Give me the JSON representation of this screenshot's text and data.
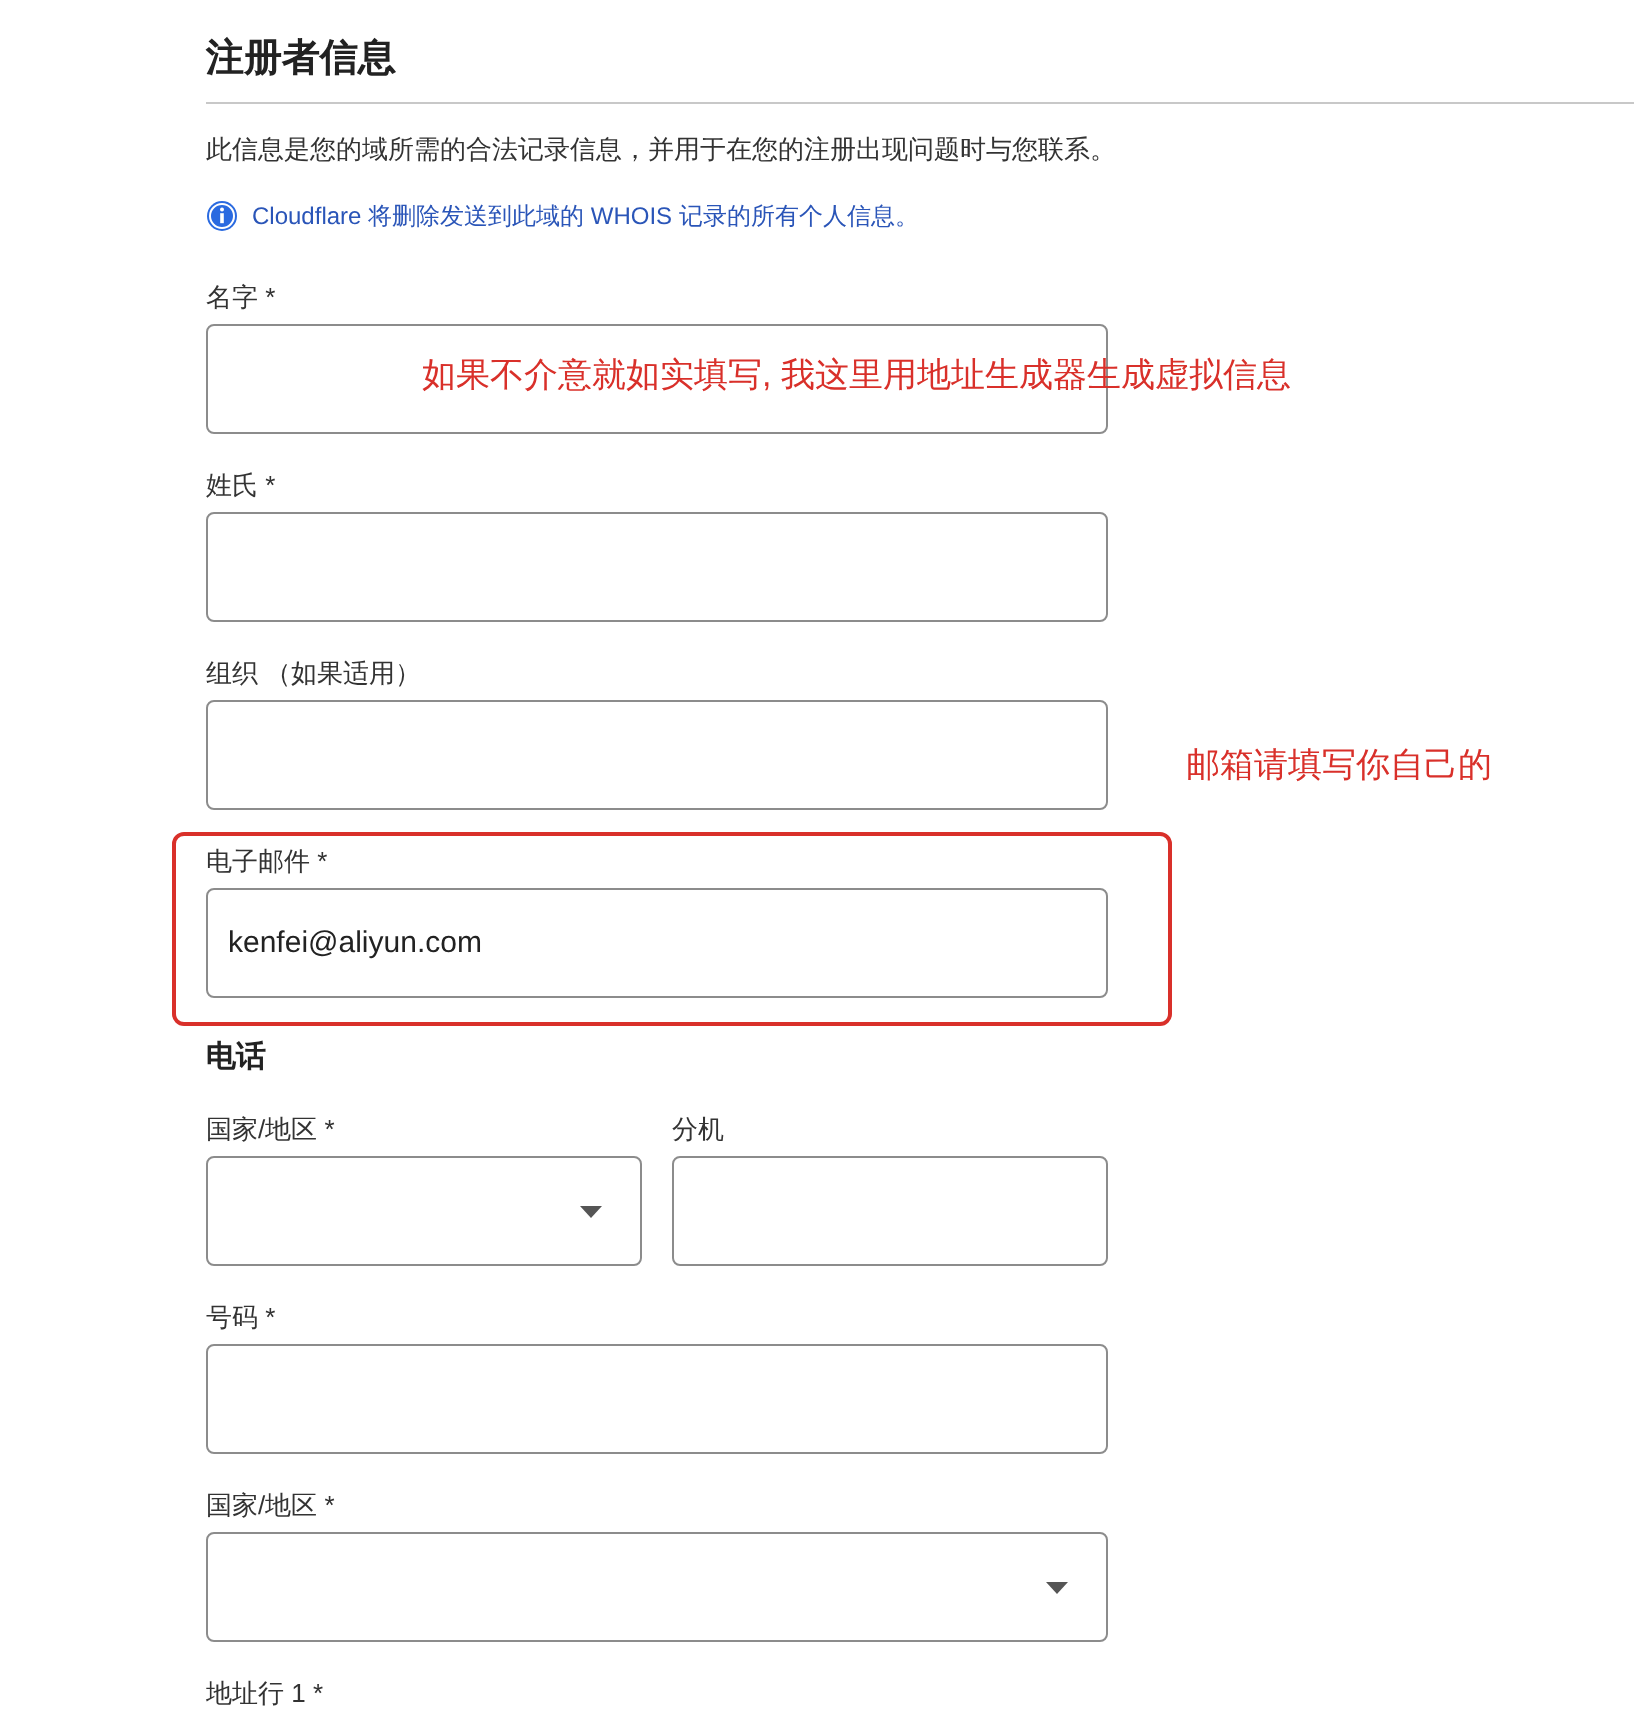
{
  "section_title": "注册者信息",
  "description": "此信息是您的域所需的合法记录信息，并用于在您的注册出现问题时与您联系。",
  "notice": {
    "text": "Cloudflare 将删除发送到此域的 WHOIS 记录的所有个人信息。"
  },
  "contact_fields": [
    {
      "label": "名字 *",
      "highlighted": false
    },
    {
      "label": "姓氏 *",
      "highlighted": false
    },
    {
      "label": "组织 （如果适用）",
      "highlighted": false
    },
    {
      "label": "电子邮件 *",
      "value": "kenfei@aliyun.com",
      "highlighted": true
    }
  ],
  "phone": {
    "title": "电话",
    "country": {
      "label": "国家/地区 *"
    },
    "extension": {
      "label": "分机"
    },
    "number": {
      "label": "号码 *"
    }
  },
  "address": {
    "country": {
      "label": "国家/地区 *"
    },
    "line_1_label": "地址行 1 *"
  },
  "annotations": [
    {
      "text": "如果不介意就如实填写, 我这里用地址生成器生成虚拟信息"
    },
    {
      "text": "邮箱请填写你自己的"
    }
  ]
}
